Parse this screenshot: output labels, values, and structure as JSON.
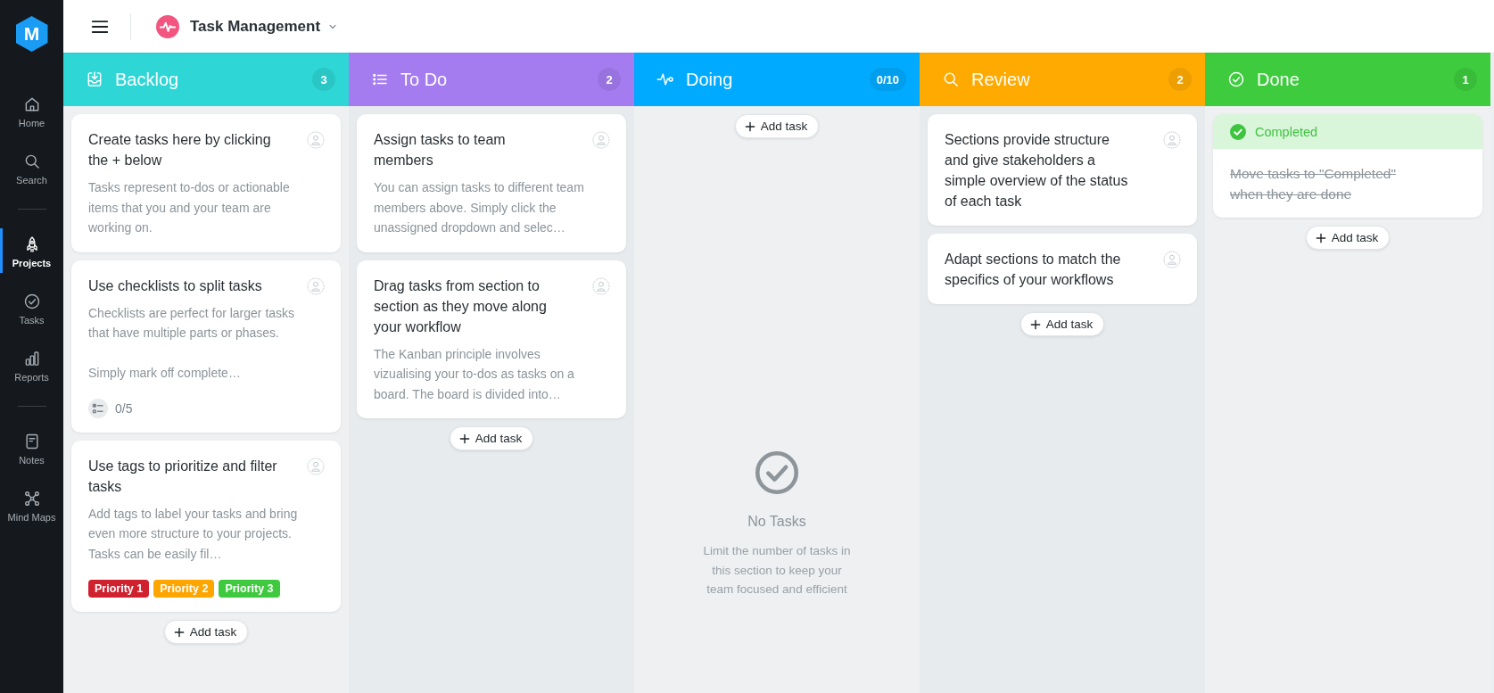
{
  "sidebar": {
    "logo": "M",
    "groups": [
      {
        "items": [
          {
            "label": "Home",
            "selected": false
          },
          {
            "label": "Search",
            "selected": false
          }
        ]
      },
      {
        "items": [
          {
            "label": "Projects",
            "selected": true
          },
          {
            "label": "Tasks",
            "selected": false
          },
          {
            "label": "Reports",
            "selected": false
          }
        ]
      },
      {
        "items": [
          {
            "label": "Notes",
            "selected": false
          },
          {
            "label": "Mind Maps",
            "selected": false
          }
        ]
      }
    ]
  },
  "header": {
    "project": "Task Management"
  },
  "columns": [
    {
      "title": "Backlog",
      "count": "3",
      "color": "#2ed6d6",
      "add_button": "Add task",
      "tasks": [
        {
          "title": "Create tasks here by clicking the + below",
          "description": "Tasks represent to-dos or actionable items that you and your team are working on.",
          "completed": false
        },
        {
          "title": "Use checklists to split tasks",
          "description": "Checklists are perfect for larger tasks that have multiple parts or phases.\n\nSimply mark off complete…",
          "checklist": "0/5",
          "completed": false
        },
        {
          "title": "Use tags to prioritize and filter tasks",
          "description": "Add tags to label your tasks and bring even more structure to your projects. Tasks can be easily fil…",
          "tags": [
            {
              "label": "Priority 1",
              "color": "#d0212f"
            },
            {
              "label": "Priority 2",
              "color": "#ffa500"
            },
            {
              "label": "Priority 3",
              "color": "#3ec93e"
            }
          ],
          "completed": false
        }
      ]
    },
    {
      "title": "To Do",
      "count": "2",
      "color": "#a47cf0",
      "add_button": "Add task",
      "tasks": [
        {
          "title": "Assign tasks to team members",
          "description": "You can assign tasks to different team members above. Simply click the unassigned dropdown and selec…",
          "completed": false
        },
        {
          "title": "Drag tasks from section to section as they move along your workflow",
          "description": "The Kanban principle involves vizualising your to-dos as tasks on a board. The board is divided into…",
          "completed": false
        }
      ]
    },
    {
      "title": "Doing",
      "count": "0/10",
      "color": "#00aaff",
      "add_button": "Add task",
      "empty_state": {
        "title": "No Tasks",
        "text": "Limit the number of tasks in this section to keep your team focused and efficient"
      }
    },
    {
      "title": "Review",
      "count": "2",
      "color": "#ffaa00",
      "add_button": "Add task",
      "tasks": [
        {
          "title": "Sections provide structure and give stakeholders a simple overview of the status of each task",
          "completed": false
        },
        {
          "title": "Adapt sections to match the specifics of your workflows",
          "completed": false
        }
      ]
    },
    {
      "title": "Done",
      "count": "1",
      "color": "#3ecb3e",
      "add_button": "Add task",
      "tasks": [
        {
          "title": "Move tasks to \"Completed\" when they are done",
          "status": "Completed",
          "completed": true
        }
      ]
    }
  ]
}
